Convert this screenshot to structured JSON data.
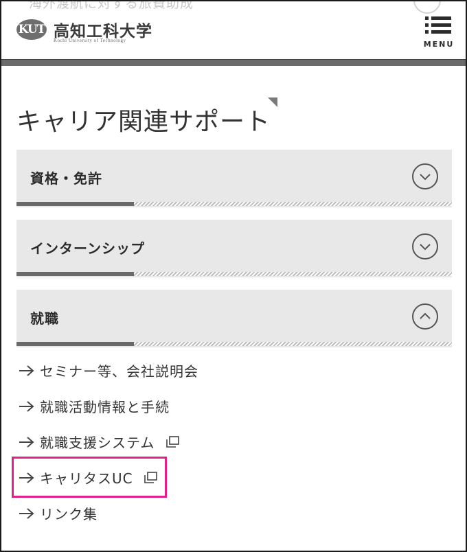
{
  "header": {
    "ghost_text": "海外渡航に対する旅費助成",
    "logo_mark": "KUT",
    "logo_name": "高知工科大学",
    "logo_sub": "Kochi University of Technology",
    "menu_label": "MENU"
  },
  "section": {
    "title": "キャリア関連サポート"
  },
  "accordion": [
    {
      "label": "資格・免許",
      "state": "collapsed",
      "progress": 0.27
    },
    {
      "label": "インターンシップ",
      "state": "collapsed",
      "progress": 0.27
    },
    {
      "label": "就職",
      "state": "expanded",
      "progress": 0.27
    }
  ],
  "links": [
    {
      "label": "セミナー等、会社説明会",
      "external": false
    },
    {
      "label": "就職活動情報と手続",
      "external": false
    },
    {
      "label": "就職支援システム",
      "external": true
    },
    {
      "label": "キャリタスUC",
      "external": true,
      "highlighted": true
    },
    {
      "label": "リンク集",
      "external": false
    }
  ],
  "colors": {
    "highlight": "#e0218a",
    "accordion_bg": "#e8e8e8",
    "header_rule": "#6b6b6b"
  },
  "icons": {
    "menu": "hamburger-icon",
    "collapsed": "chevron-down-icon",
    "expanded": "chevron-up-icon",
    "link": "arrow-right-icon",
    "external": "external-link-icon"
  }
}
